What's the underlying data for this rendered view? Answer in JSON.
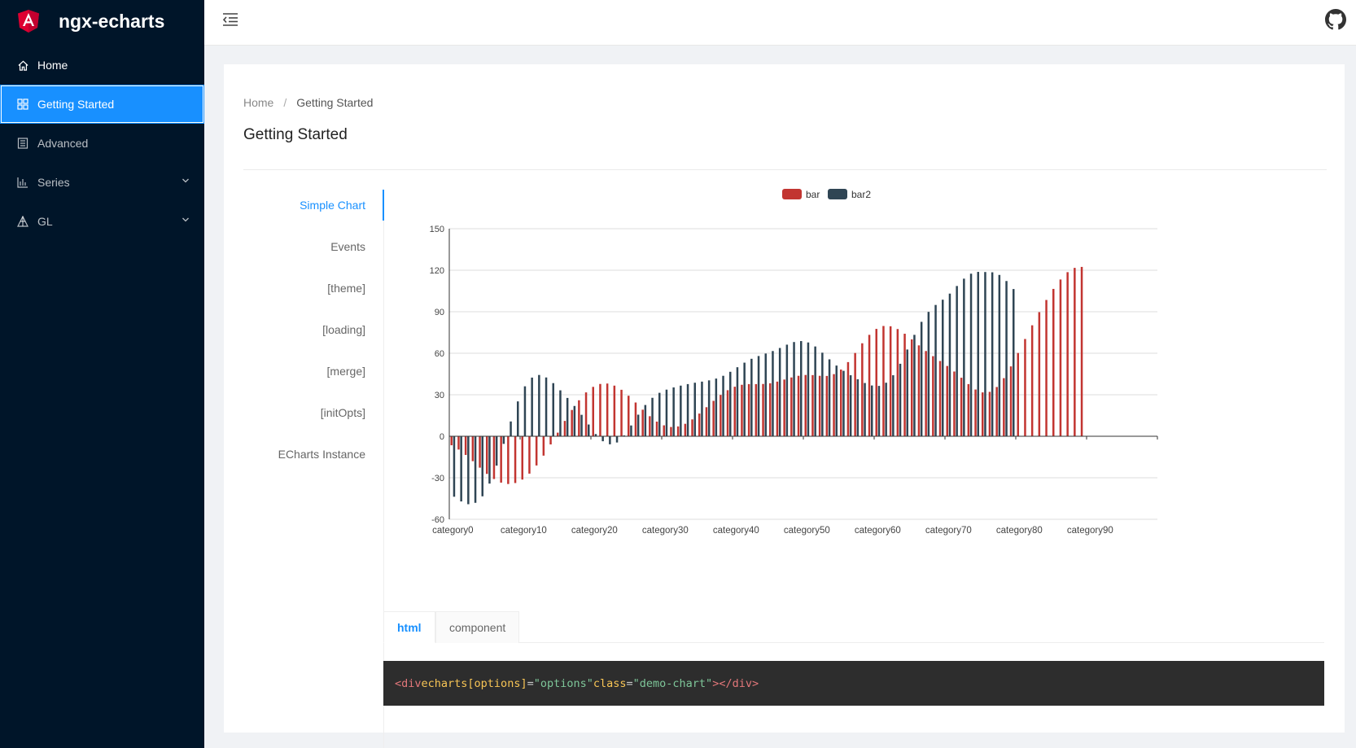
{
  "app": {
    "title": "ngx-echarts"
  },
  "sidebar": {
    "items": [
      {
        "label": "Home",
        "icon": "home-icon"
      },
      {
        "label": "Getting Started",
        "icon": "appstore-icon"
      },
      {
        "label": "Advanced",
        "icon": "calculator-icon"
      },
      {
        "label": "Series",
        "icon": "bar-chart-icon"
      },
      {
        "label": "GL",
        "icon": "3d-icon"
      }
    ]
  },
  "breadcrumb": {
    "home": "Home",
    "separator": "/",
    "current": "Getting Started"
  },
  "page": {
    "title": "Getting Started"
  },
  "demo_tabs": [
    "Simple Chart",
    "Events",
    "[theme]",
    "[loading]",
    "[merge]",
    "[initOpts]",
    "ECharts Instance"
  ],
  "code_tabs": {
    "html": "html",
    "component": "component"
  },
  "code": {
    "tag_open": "<div",
    "attr1": "echarts",
    "attr2": "[options]",
    "eq1": "=",
    "val2": "\"options\"",
    "attr3": "class",
    "eq2": "=",
    "val3": "\"demo-chart\"",
    "tag_close": "></div>"
  },
  "colors": {
    "sidebar_bg": "#001529",
    "accent": "#1890ff",
    "bar": "#c23531",
    "bar2": "#2f4554"
  },
  "chart_data": {
    "type": "bar",
    "legend": [
      "bar",
      "bar2"
    ],
    "legend_position": "top-center",
    "categories_count": 100,
    "category_prefix": "category",
    "x_tick_labels": [
      "category0",
      "category10",
      "category20",
      "category30",
      "category40",
      "category50",
      "category60",
      "category70",
      "category80",
      "category90"
    ],
    "ylim": [
      -60,
      150
    ],
    "yticks": [
      "150",
      "120",
      "90",
      "60",
      "30",
      "0",
      "-30",
      "-60"
    ],
    "grid": "horizontal",
    "series": [
      {
        "name": "bar",
        "values": [
          -6.5,
          -9.6,
          -13.5,
          -18,
          -22.7,
          -27.2,
          -30.9,
          -33.5,
          -34.5,
          -33.8,
          -31.3,
          -27,
          -21.1,
          -14,
          -5.9,
          2.6,
          11.1,
          19,
          26,
          31.7,
          35.7,
          37.8,
          38.1,
          36.6,
          33.6,
          29.3,
          24.4,
          19.2,
          14.5,
          10.6,
          7.9,
          6.7,
          7.1,
          9,
          12.2,
          16.4,
          21,
          25.6,
          29.9,
          33.3,
          35.8,
          37.2,
          37.7,
          37.7,
          37.8,
          38.3,
          39.5,
          41,
          42.5,
          43.7,
          44.3,
          44.2,
          43.7,
          43.6,
          44.9,
          48.2,
          53.6,
          60.2,
          67.2,
          73.3,
          77.6,
          79.7,
          79.5,
          77.5,
          74.1,
          70,
          65.7,
          61.6,
          57.9,
          54.4,
          50.8,
          46.8,
          42.3,
          37.7,
          33.8,
          31.7,
          32.1,
          35.6,
          42,
          50.5,
          60.2,
          70.3,
          80.2,
          89.7,
          98.5,
          106.5,
          113.3,
          118.6,
          121.7,
          122.4
        ]
      },
      {
        "name": "bar2",
        "values": [
          -43.7,
          -47.1,
          -49.1,
          -48.1,
          -43.4,
          -34.2,
          -21.2,
          -5.5,
          10.7,
          25.2,
          36.1,
          42.4,
          44.3,
          42.5,
          38.4,
          33.2,
          27.7,
          21.9,
          15.5,
          8.5,
          1.6,
          -3.6,
          -5.8,
          -4.5,
          0.6,
          7.8,
          15.6,
          22.6,
          27.8,
          31.4,
          33.7,
          35.3,
          36.6,
          37.7,
          38.7,
          39.5,
          40.4,
          41.7,
          43.7,
          46.6,
          49.9,
          53.2,
          56,
          58,
          59.8,
          61.6,
          63.8,
          66.2,
          68.1,
          68.8,
          67.8,
          64.9,
          60.4,
          55.6,
          51.1,
          47.3,
          44.1,
          41.2,
          38.5,
          36.7,
          36.4,
          38.7,
          44.1,
          52.4,
          62.7,
          73.3,
          82.7,
          89.9,
          94.9,
          98.7,
          103.1,
          108.6,
          113.9,
          117.5,
          118.8,
          118.7,
          118.5,
          116.6,
          112.2,
          106.4
        ]
      }
    ]
  }
}
